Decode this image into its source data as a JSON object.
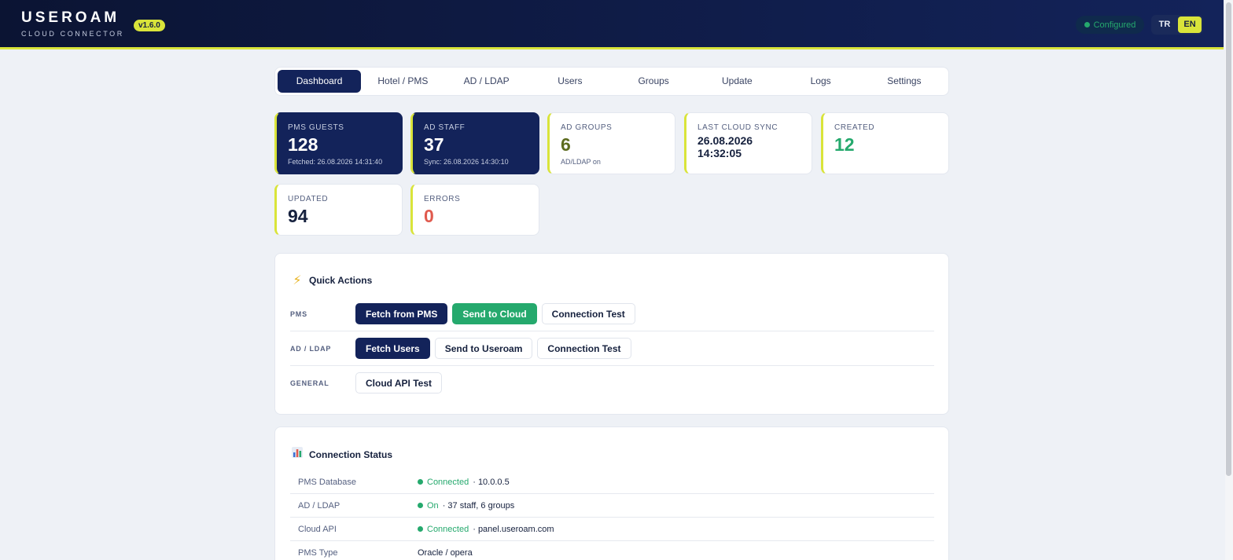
{
  "header": {
    "brand": "USEROAM",
    "subtitle": "CLOUD CONNECTOR",
    "version": "v1.6.0",
    "status": "Configured",
    "lang_tr": "TR",
    "lang_en": "EN"
  },
  "nav": [
    "Dashboard",
    "Hotel / PMS",
    "AD / LDAP",
    "Users",
    "Groups",
    "Update",
    "Logs",
    "Settings"
  ],
  "stats": {
    "pms_guests": {
      "label": "PMS GUESTS",
      "value": "128",
      "sub": "Fetched: 26.08.2026 14:31:40"
    },
    "ad_staff": {
      "label": "AD STAFF",
      "value": "37",
      "sub": "Sync: 26.08.2026 14:30:10"
    },
    "ad_groups": {
      "label": "AD GROUPS",
      "value": "6",
      "sub": "AD/LDAP on"
    },
    "last_sync": {
      "label": "LAST CLOUD SYNC",
      "date": "26.08.2026",
      "time": "14:32:05"
    },
    "created": {
      "label": "CREATED",
      "value": "12"
    },
    "updated": {
      "label": "UPDATED",
      "value": "94"
    },
    "errors": {
      "label": "ERRORS",
      "value": "0"
    }
  },
  "quick_actions": {
    "title": "Quick Actions",
    "pms_label": "PMS",
    "pms_fetch": "Fetch from PMS",
    "pms_send": "Send to Cloud",
    "pms_test": "Connection Test",
    "ad_label": "AD / LDAP",
    "ad_fetch": "Fetch Users",
    "ad_send": "Send to Useroam",
    "ad_test": "Connection Test",
    "general_label": "GENERAL",
    "cloud_test": "Cloud API Test"
  },
  "connection_status": {
    "title": "Connection Status",
    "rows": [
      {
        "key": "PMS Database",
        "state": "Connected",
        "detail": " · 10.0.0.5"
      },
      {
        "key": "AD / LDAP",
        "state": "On",
        "detail": " · 37 staff, 6 groups"
      },
      {
        "key": "Cloud API",
        "state": "Connected",
        "detail": " · panel.useroam.com"
      },
      {
        "key": "PMS Type",
        "state": "",
        "detail": "Oracle / opera"
      }
    ]
  },
  "colors": {
    "accent": "#d9e43a",
    "navy": "#13235a",
    "green": "#25a96d",
    "error": "#e05a4e",
    "olive": "#5c6b1e"
  }
}
